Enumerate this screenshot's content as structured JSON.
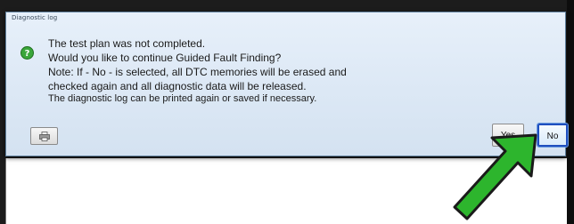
{
  "dialog": {
    "caption": "Diagnostic log",
    "message_lines": [
      "The test plan was not completed.",
      "Would you like to continue Guided Fault Finding?",
      "Note: If - No - is selected, all DTC memories will be erased and",
      "checked again and all diagnostic data will be released.",
      "The diagnostic log can be printed again or saved if necessary."
    ],
    "icon": "question-icon",
    "buttons": {
      "yes_label": "Yes",
      "no_label": "No"
    },
    "print_icon": "printer-icon"
  },
  "annotation": {
    "icon": "green-arrow-pointer",
    "color": "#2db52d"
  },
  "colors": {
    "dialog_bg": "#dce8f5",
    "focus_border": "#1f4fbf",
    "icon_green": "#3aa63a"
  }
}
